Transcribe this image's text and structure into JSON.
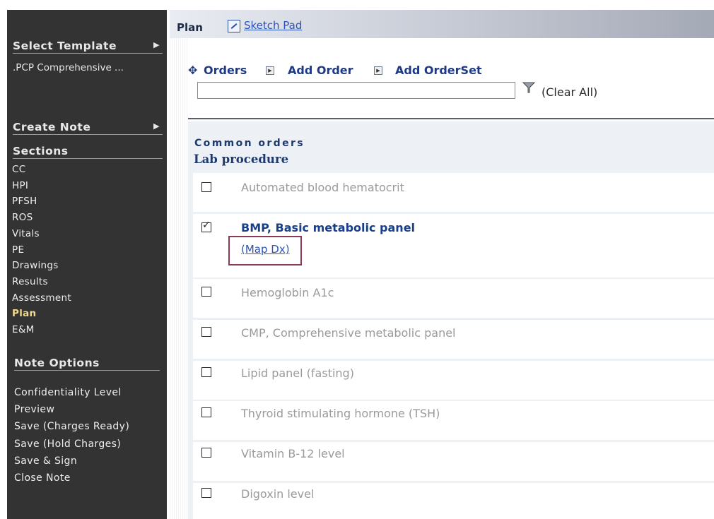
{
  "sidebar": {
    "select_template": "Select Template",
    "template_value": ".PCP Comprehensive ...",
    "create_note": "Create Note",
    "sections_header": "Sections",
    "sections": [
      "CC",
      "HPI",
      "PFSH",
      "ROS",
      "Vitals",
      "PE",
      "Drawings",
      "Results",
      "Assessment",
      "Plan",
      "E&M"
    ],
    "active_section": "Plan",
    "note_options_header": "Note Options",
    "note_options": [
      "Confidentiality Level",
      "Preview",
      "Save (Charges Ready)",
      "Save (Hold Charges)",
      "Save & Sign",
      "Close Note"
    ]
  },
  "tabbar": {
    "plan": "Plan",
    "sketch_pad": "Sketch Pad"
  },
  "toolbar": {
    "orders": "Orders",
    "add_order": "Add Order",
    "add_orderset": "Add OrderSet",
    "search_value": "",
    "clear_all": "(Clear All)"
  },
  "panel": {
    "section_title": "Common orders",
    "group_title": "Lab procedure",
    "orders": [
      {
        "label": "Automated blood hematocrit",
        "checked": false
      },
      {
        "label": "BMP, Basic metabolic panel",
        "checked": true,
        "map_dx": "(Map Dx)"
      },
      {
        "label": "Hemoglobin A1c",
        "checked": false
      },
      {
        "label": "CMP, Comprehensive metabolic panel",
        "checked": false
      },
      {
        "label": "Lipid panel (fasting)",
        "checked": false
      },
      {
        "label": "Thyroid stimulating hormone (TSH)",
        "checked": false
      },
      {
        "label": "Vitamin B-12 level",
        "checked": false
      },
      {
        "label": "Digoxin level",
        "checked": false
      }
    ]
  },
  "colors": {
    "sidebar_bg": "#333333",
    "active_section": "#f2d88a",
    "link": "#2a54b8",
    "highlight_box": "#8a3a56"
  }
}
